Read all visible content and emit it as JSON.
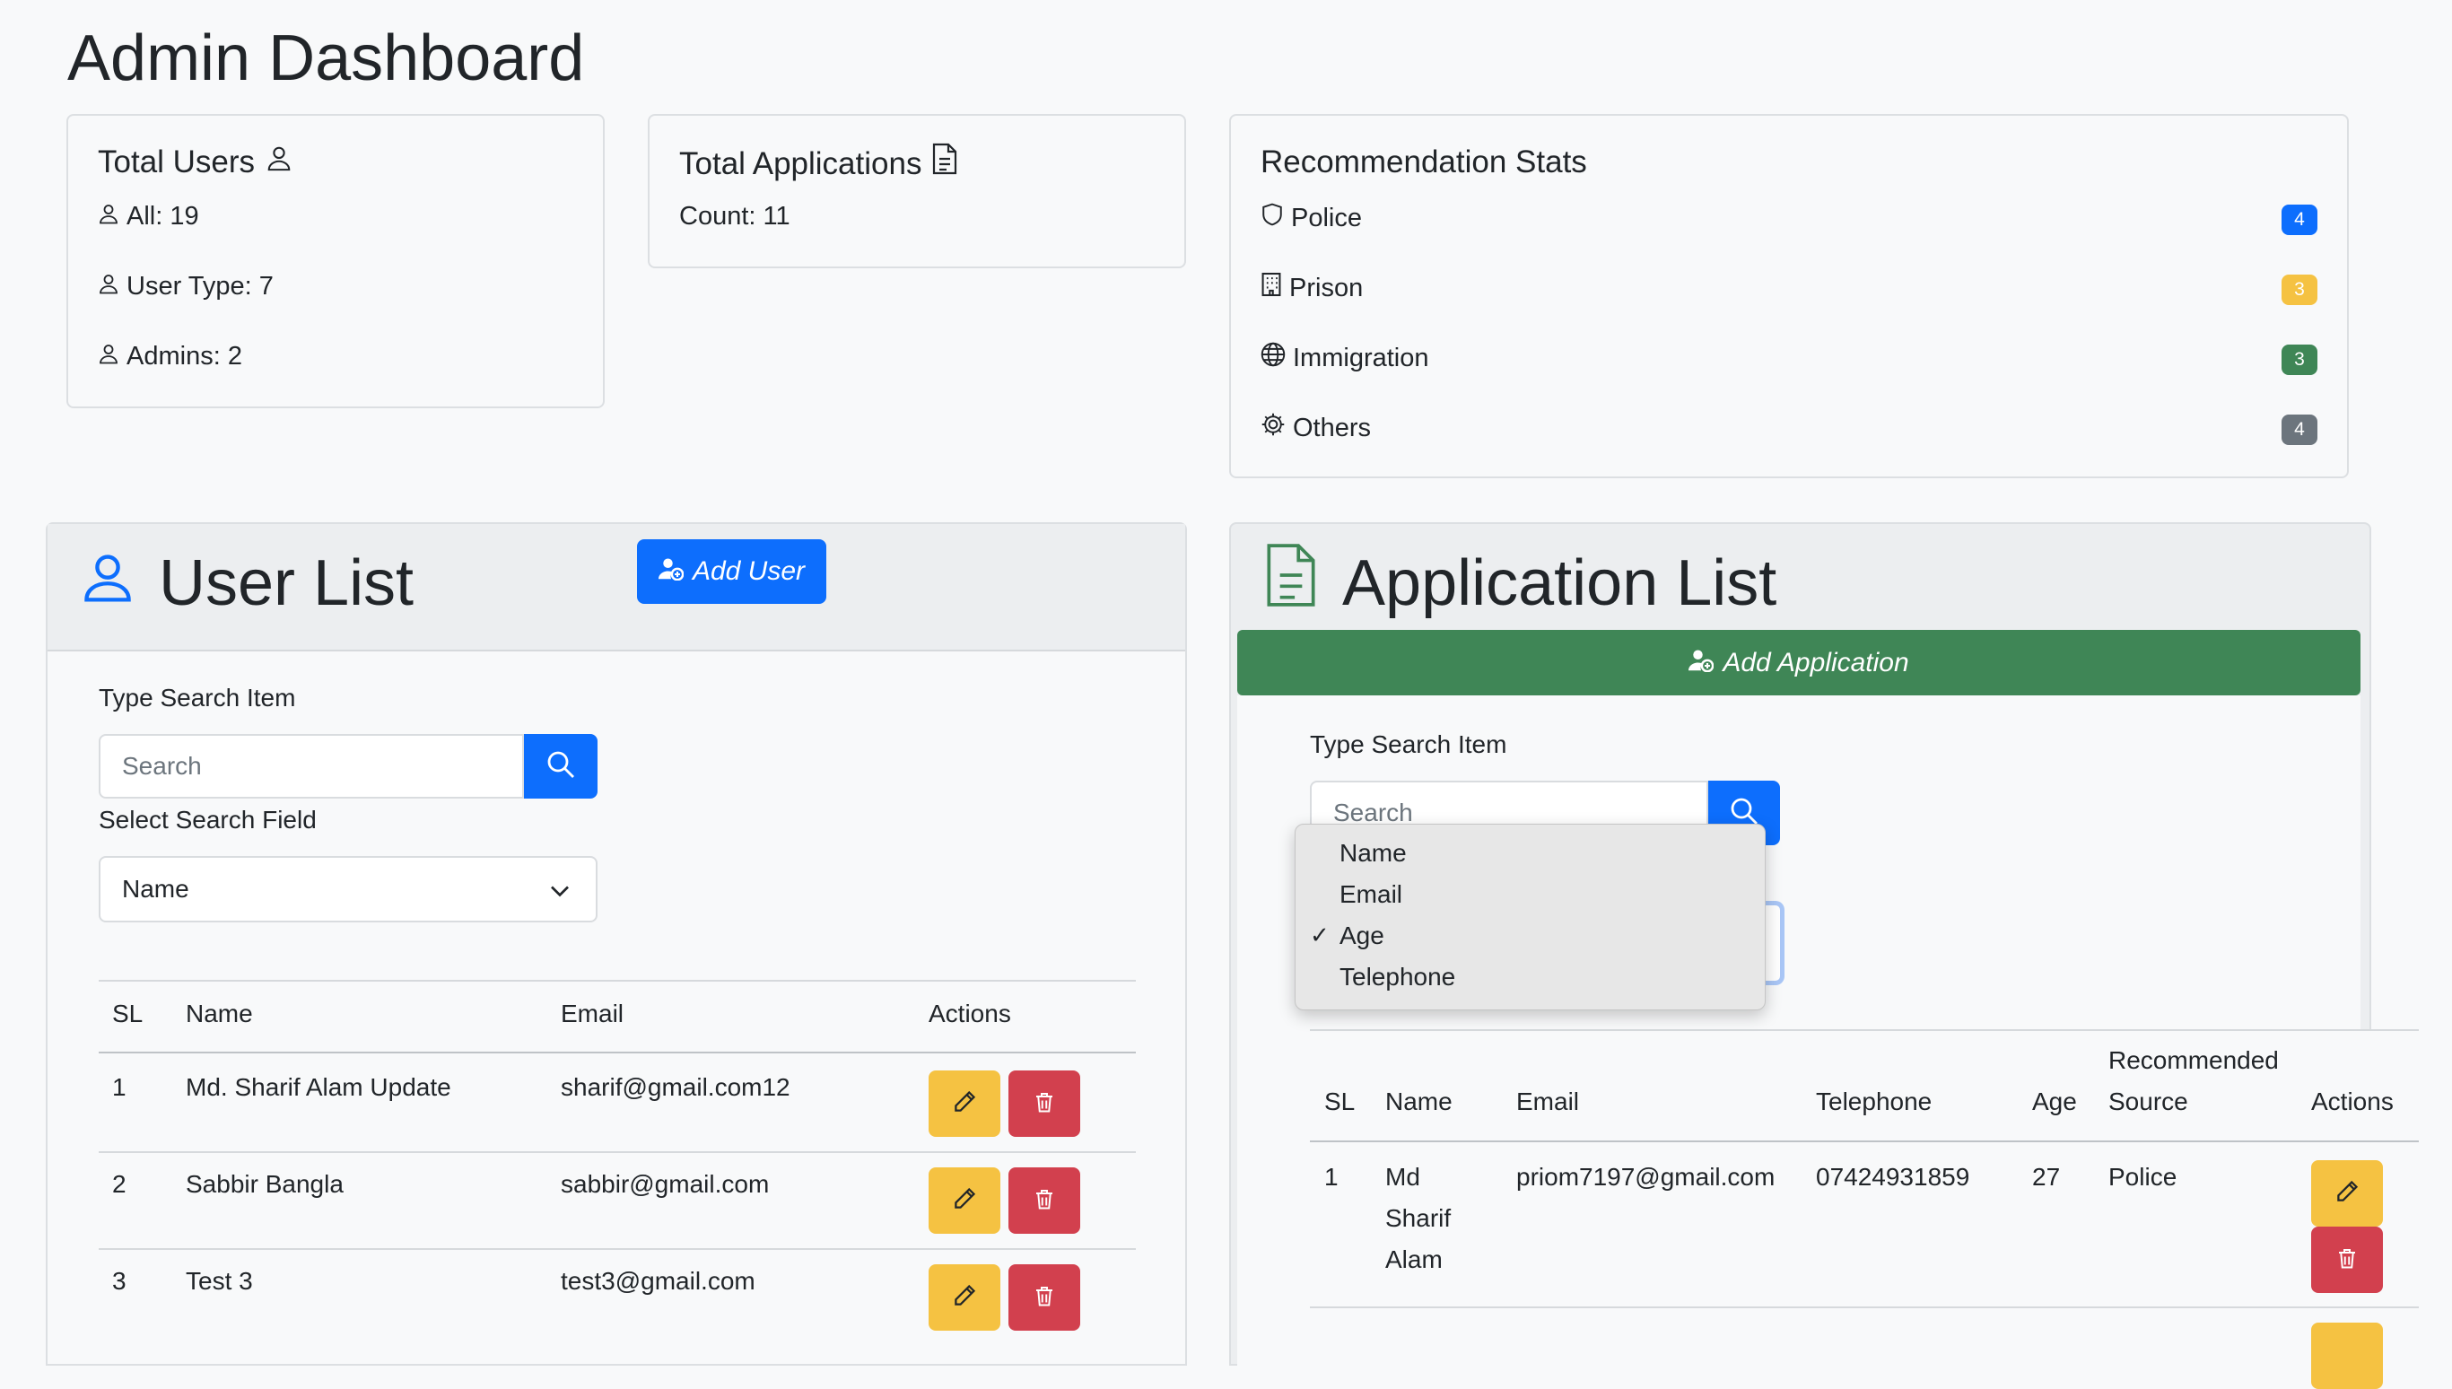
{
  "page_title": "Admin Dashboard",
  "cards": {
    "users": {
      "title": "Total Users",
      "lines": [
        "All: 19",
        "User Type: 7",
        "Admins: 2"
      ]
    },
    "applications": {
      "title": "Total Applications",
      "count": "Count: 11"
    },
    "recommendations": {
      "title": "Recommendation Stats",
      "items": [
        {
          "label": "Police",
          "count": "4",
          "color": "#0d6efd"
        },
        {
          "label": "Prison",
          "count": "3",
          "color": "#f5c242"
        },
        {
          "label": "Immigration",
          "count": "3",
          "color": "#3f8656"
        },
        {
          "label": "Others",
          "count": "4",
          "color": "#6c757d"
        }
      ]
    }
  },
  "user_list": {
    "title": "User List",
    "add_button": "Add User",
    "search_label": "Type Search Item",
    "search_placeholder": "Search",
    "field_label": "Select Search Field",
    "field_value": "Name",
    "columns": [
      "SL",
      "Name",
      "Email",
      "Actions"
    ],
    "rows": [
      {
        "sl": "1",
        "name": "Md. Sharif Alam Update",
        "email": "sharif@gmail.com12"
      },
      {
        "sl": "2",
        "name": "Sabbir Bangla",
        "email": "sabbir@gmail.com"
      },
      {
        "sl": "3",
        "name": "Test 3",
        "email": "test3@gmail.com"
      }
    ]
  },
  "application_list": {
    "title": "Application List",
    "add_button": "Add Application",
    "search_label": "Type Search Item",
    "search_placeholder": "Search",
    "dropdown_options": [
      "Name",
      "Email",
      "Age",
      "Telephone"
    ],
    "dropdown_selected": "Age",
    "columns": {
      "sl": "SL",
      "name": "Name",
      "email": "Email",
      "telephone": "Telephone",
      "age": "Age",
      "source_line1": "Recommended",
      "source_line2": "Source",
      "actions": "Actions"
    },
    "rows": [
      {
        "sl": "1",
        "name_lines": [
          "Md",
          "Sharif",
          "Alam"
        ],
        "email": "priom7197@gmail.com",
        "telephone": "07424931859",
        "age": "27",
        "source": "Police"
      }
    ]
  },
  "colors": {
    "primary": "#0d6efd",
    "success": "#3f8656",
    "warning": "#f5c242",
    "danger": "#d2404e",
    "secondary": "#6c757d"
  }
}
